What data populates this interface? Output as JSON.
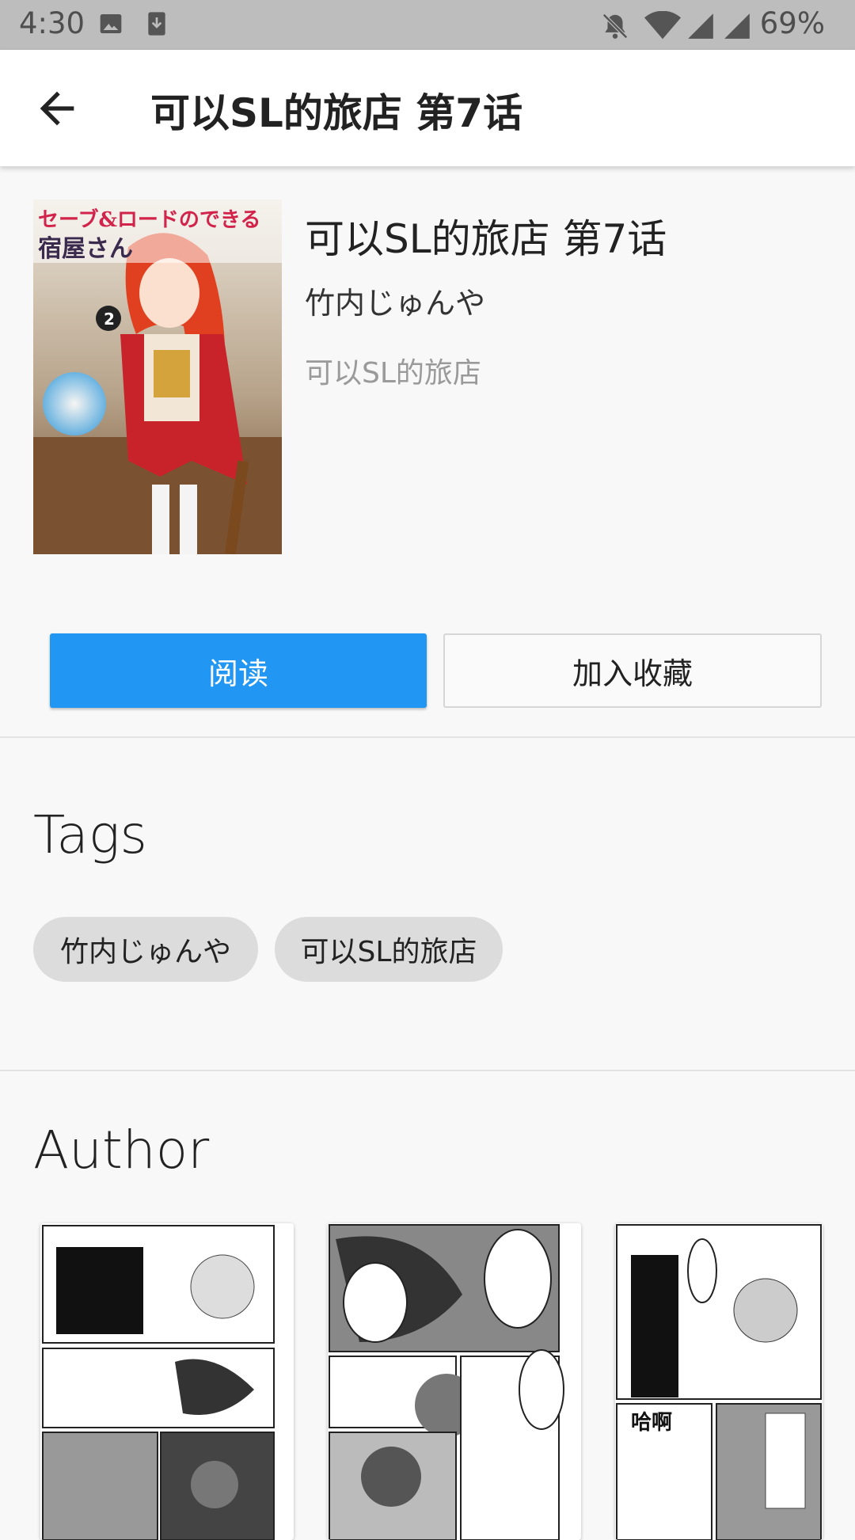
{
  "status_bar": {
    "time": "4:30",
    "battery": "69%",
    "icons": [
      "image-icon",
      "download-icon",
      "bell-muted-icon",
      "wifi-icon",
      "signal-icon",
      "signal-icon"
    ]
  },
  "app_bar": {
    "title": "可以SL的旅店 第7话",
    "back_icon": "arrow-back-icon"
  },
  "detail": {
    "title": "可以SL的旅店 第7话",
    "author": "竹内じゅんや",
    "series": "可以SL的旅店",
    "cover_text": "セーブ&ロードのできる宿屋さん"
  },
  "actions": {
    "read_label": "阅读",
    "favorite_label": "加入收藏"
  },
  "tags": {
    "heading": "Tags",
    "items": [
      "竹内じゅんや",
      "可以SL的旅店"
    ]
  },
  "author_section": {
    "heading": "Author"
  },
  "colors": {
    "accent": "#2196f3",
    "status_bar": "#bdbdbd",
    "chip": "#dcdcdc",
    "background": "#f8f8f8"
  }
}
